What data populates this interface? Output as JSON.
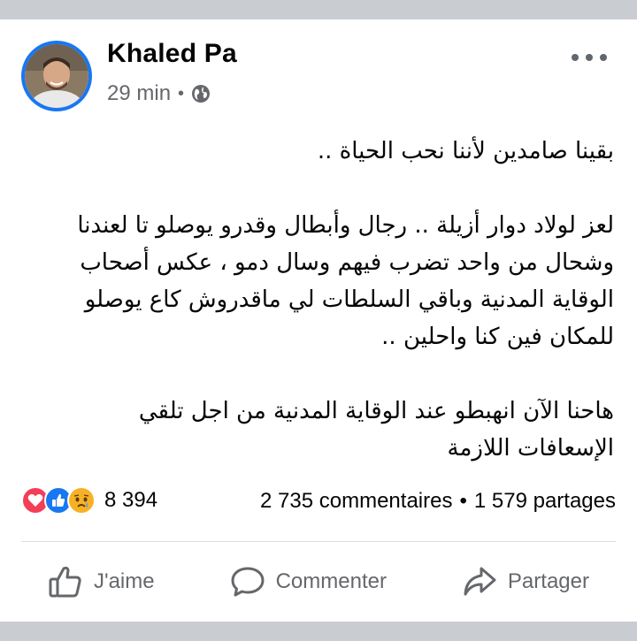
{
  "post": {
    "author": "Khaled Pa",
    "time": "29 min",
    "separator": "•",
    "privacy_icon": "globe-icon",
    "more_icon": "more-dots-icon",
    "body": {
      "line1": "بقينا صامدين لأننا نحب الحياة ..",
      "line2": "لعز لولاد دوار أزيلة .. رجال وأبطال وقدرو يوصلو تا لعندنا",
      "line3": "وشحال من واحد تضرب فيهم وسال دمو ، عكس أصحاب",
      "line4": "الوقاية المدنية وباقي السلطات لي ماقدروش كاع يوصلو",
      "line5": "للمكان فين كنا واحلين ..",
      "line6": "هاحنا الآن انهبطو عند الوقاية المدنية من اجل تلقي",
      "line7": "الإسعافات اللازمة"
    }
  },
  "reactions": {
    "icons": [
      "love-icon",
      "like-icon",
      "sad-icon"
    ],
    "count": "8 394"
  },
  "stats": {
    "comments": "2 735 commentaires",
    "separator": "•",
    "shares": "1 579 partages"
  },
  "actions": {
    "like_label": "J'aime",
    "comment_label": "Commenter",
    "share_label": "Partager"
  },
  "colors": {
    "brand_blue": "#1877f2",
    "love_red": "#f33e58",
    "sad_yellow": "#f7b125",
    "secondary_text": "#65676b"
  }
}
